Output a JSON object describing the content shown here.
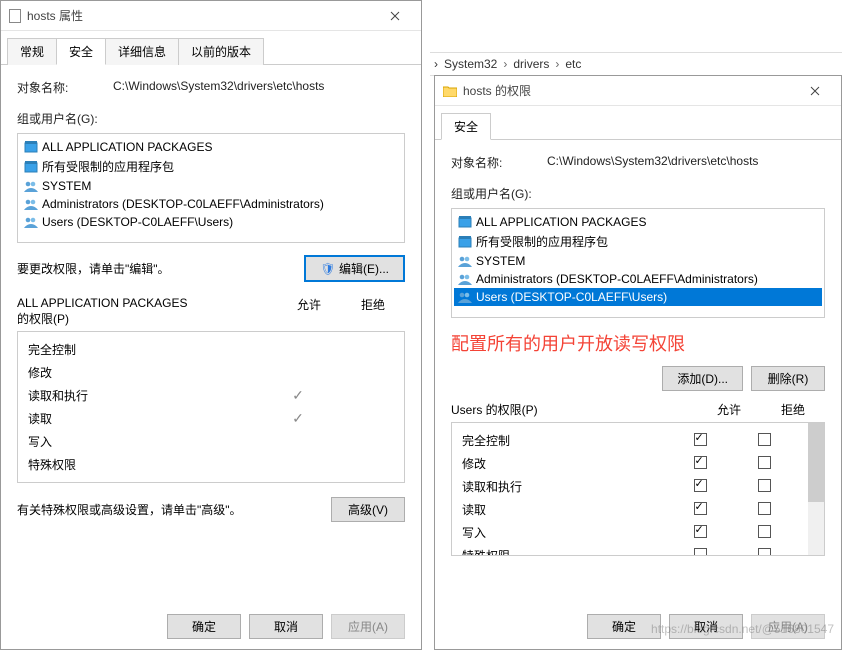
{
  "breadcrumb": {
    "items": [
      "System32",
      "drivers",
      "etc"
    ]
  },
  "left": {
    "title": "hosts 属性",
    "tabs": [
      "常规",
      "安全",
      "详细信息",
      "以前的版本"
    ],
    "active_tab": 1,
    "object_label": "对象名称:",
    "object_value": "C:\\Windows\\System32\\drivers\\etc\\hosts",
    "group_label": "组或用户名(G):",
    "group_items": [
      "ALL APPLICATION PACKAGES",
      "所有受限制的应用程序包",
      "SYSTEM",
      "Administrators (DESKTOP-C0LAEFF\\Administrators)",
      "Users (DESKTOP-C0LAEFF\\Users)"
    ],
    "edit_hint": "要更改权限，请单击\"编辑\"。",
    "edit_btn": "编辑(E)...",
    "perm_title_prefix": "ALL APPLICATION PACKAGES",
    "perm_title_suffix": "的权限(P)",
    "col_allow": "允许",
    "col_deny": "拒绝",
    "perms": [
      {
        "name": "完全控制",
        "allow": false
      },
      {
        "name": "修改",
        "allow": false
      },
      {
        "name": "读取和执行",
        "allow": true
      },
      {
        "name": "读取",
        "allow": true
      },
      {
        "name": "写入",
        "allow": false
      },
      {
        "name": "特殊权限",
        "allow": false
      }
    ],
    "advanced_hint": "有关特殊权限或高级设置，请单击\"高级\"。",
    "advanced_btn": "高级(V)",
    "ok": "确定",
    "cancel": "取消",
    "apply": "应用(A)"
  },
  "right": {
    "title": "hosts 的权限",
    "tabs": [
      "安全"
    ],
    "object_label": "对象名称:",
    "object_value": "C:\\Windows\\System32\\drivers\\etc\\hosts",
    "group_label": "组或用户名(G):",
    "group_items": [
      "ALL APPLICATION PACKAGES",
      "所有受限制的应用程序包",
      "SYSTEM",
      "Administrators (DESKTOP-C0LAEFF\\Administrators)",
      "Users (DESKTOP-C0LAEFF\\Users)"
    ],
    "selected_index": 4,
    "annotation": "配置所有的用户开放读写权限",
    "add_btn": "添加(D)...",
    "remove_btn": "删除(R)",
    "perm_title": "Users 的权限(P)",
    "col_allow": "允许",
    "col_deny": "拒绝",
    "perms": [
      {
        "name": "完全控制",
        "allow": true,
        "deny": false
      },
      {
        "name": "修改",
        "allow": true,
        "deny": false
      },
      {
        "name": "读取和执行",
        "allow": true,
        "deny": false
      },
      {
        "name": "读取",
        "allow": true,
        "deny": false
      },
      {
        "name": "写入",
        "allow": true,
        "deny": false
      },
      {
        "name": "特殊权限",
        "allow": false,
        "deny": false
      }
    ],
    "ok": "确定",
    "cancel": "取消",
    "apply": "应用(A)"
  },
  "watermark": "https://blog.csdn.net/@516801547"
}
